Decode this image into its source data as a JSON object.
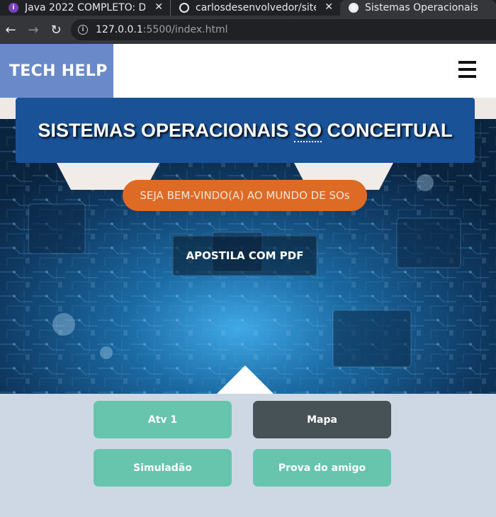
{
  "browser": {
    "tabs": [
      {
        "label": "Java 2022 COMPLETO: Do",
        "icon": "app-icon"
      },
      {
        "label": "carlosdesenvolvedor/site",
        "icon": "github-icon"
      },
      {
        "label": "Sistemas Operacionais",
        "icon": "globe-icon"
      }
    ],
    "close_glyph": "✕",
    "url_host": "127.0.0.1",
    "url_rest": ":5500/index.html"
  },
  "site": {
    "brand": "TECH HELP",
    "title_before": "SISTEMAS OPERACIONAIS ",
    "title_abbr": "SO",
    "title_after": " CONCEITUAL",
    "welcome": "SEJA BEM-VINDO(A) AO MUNDO DE SOs",
    "pdf_button": "APOSTILA COM PDF",
    "actions": [
      {
        "label": "Atv 1",
        "color": "#67c5ad"
      },
      {
        "label": "Mapa",
        "color": "#475256"
      },
      {
        "label": "Simuladão",
        "color": "#67c5ad"
      },
      {
        "label": "Prova do amigo",
        "color": "#67c5ad"
      }
    ]
  },
  "colors": {
    "brand_bg": "#6a89c9",
    "title_bg": "#1a5298",
    "welcome_bg": "#dd6b25",
    "page_bg": "#cdd8e4"
  }
}
